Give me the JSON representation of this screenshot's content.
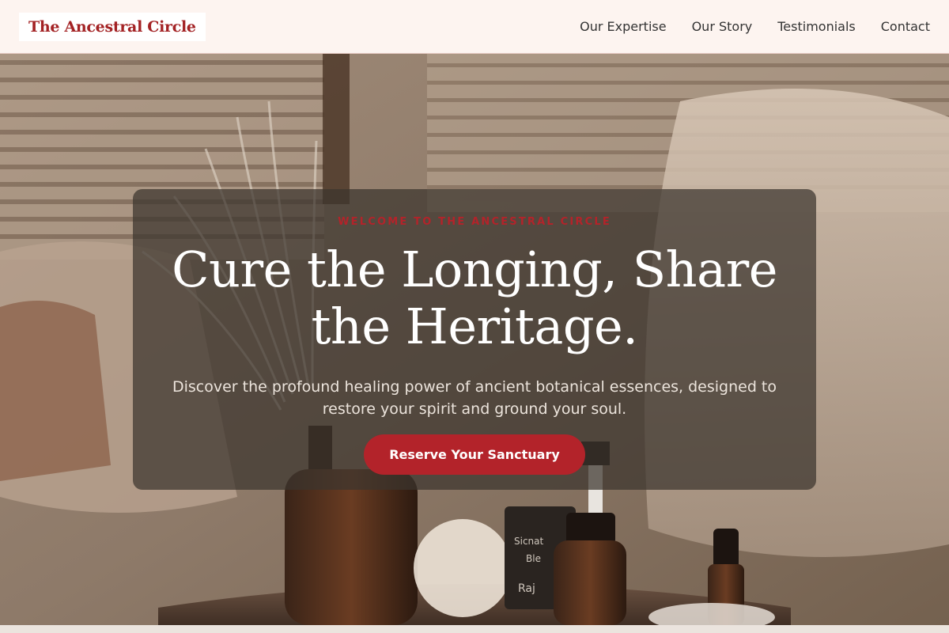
{
  "header": {
    "brand": "The Ancestral Circle",
    "nav": [
      {
        "label": "Our Expertise"
      },
      {
        "label": "Our Story"
      },
      {
        "label": "Testimonials"
      },
      {
        "label": "Contact"
      }
    ]
  },
  "hero": {
    "eyebrow": "WELCOME TO THE ANCESTRAL CIRCLE",
    "headline": "Cure the Longing, Share the Heritage.",
    "subtext": "Discover the profound healing power of ancient botanical essences, designed to restore your spirit and ground your soul.",
    "cta_label": "Reserve Your Sanctuary",
    "background_image": "spa-room-with-botanical-bottles"
  },
  "colors": {
    "accent": "#b3232a",
    "header_bg": "#fdf4f0",
    "overlay": "rgba(60, 52, 46, 0.72)"
  }
}
